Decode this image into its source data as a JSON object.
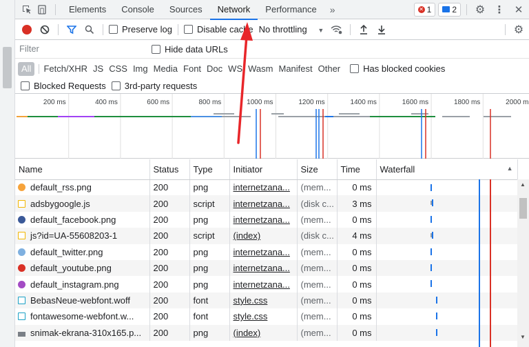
{
  "tabs": [
    "Elements",
    "Console",
    "Sources",
    "Network",
    "Performance"
  ],
  "active_tab": "Network",
  "more_tabs": "»",
  "error_count": "1",
  "message_count": "2",
  "toolbar": {
    "preserve_log": "Preserve log",
    "disable_cache": "Disable cache",
    "throttling": "No throttling"
  },
  "filter": {
    "placeholder": "Filter",
    "hide_data_urls": "Hide data URLs",
    "types": [
      "All",
      "Fetch/XHR",
      "JS",
      "CSS",
      "Img",
      "Media",
      "Font",
      "Doc",
      "WS",
      "Wasm",
      "Manifest",
      "Other"
    ],
    "has_blocked_cookies": "Has blocked cookies",
    "blocked_requests": "Blocked Requests",
    "third_party": "3rd-party requests"
  },
  "overview": {
    "ticks": [
      "200 ms",
      "400 ms",
      "600 ms",
      "800 ms",
      "1000 ms",
      "1200 ms",
      "1400 ms",
      "1600 ms",
      "1800 ms",
      "2000 ms"
    ]
  },
  "table": {
    "headers": [
      "Name",
      "Status",
      "Type",
      "Initiator",
      "Size",
      "Time",
      "Waterfall"
    ],
    "rows": [
      {
        "name": "default_rss.png",
        "icon": "rss-image-icon",
        "status": "200",
        "type": "png",
        "initiator": "internetzana...",
        "size": "(mem...",
        "time": "0 ms"
      },
      {
        "name": "adsbygoogle.js",
        "icon": "script-file-icon",
        "status": "200",
        "type": "script",
        "initiator": "internetzana...",
        "size": "(disk c...",
        "time": "3 ms"
      },
      {
        "name": "default_facebook.png",
        "icon": "facebook-image-icon",
        "status": "200",
        "type": "png",
        "initiator": "internetzana...",
        "size": "(mem...",
        "time": "0 ms"
      },
      {
        "name": "js?id=UA-55608203-1",
        "icon": "script-file-icon",
        "status": "200",
        "type": "script",
        "initiator": "(index)",
        "size": "(disk c...",
        "time": "4 ms"
      },
      {
        "name": "default_twitter.png",
        "icon": "twitter-image-icon",
        "status": "200",
        "type": "png",
        "initiator": "internetzana...",
        "size": "(mem...",
        "time": "0 ms"
      },
      {
        "name": "default_youtube.png",
        "icon": "youtube-image-icon",
        "status": "200",
        "type": "png",
        "initiator": "internetzana...",
        "size": "(mem...",
        "time": "0 ms"
      },
      {
        "name": "default_instagram.png",
        "icon": "instagram-image-icon",
        "status": "200",
        "type": "png",
        "initiator": "internetzana...",
        "size": "(mem...",
        "time": "0 ms"
      },
      {
        "name": "BebasNeue-webfont.woff",
        "icon": "font-file-icon",
        "status": "200",
        "type": "font",
        "initiator": "style.css",
        "size": "(mem...",
        "time": "0 ms"
      },
      {
        "name": "fontawesome-webfont.w...",
        "icon": "font-file-icon",
        "status": "200",
        "type": "font",
        "initiator": "style.css",
        "size": "(mem...",
        "time": "0 ms"
      },
      {
        "name": "snimak-ekrana-310x165.p...",
        "icon": "image-file-icon",
        "status": "200",
        "type": "png",
        "initiator": "(index)",
        "size": "(mem...",
        "time": "0 ms"
      }
    ]
  },
  "colors": {
    "accent": "#1a73e8",
    "record": "#d93025",
    "annotation_arrow": "#e8262a"
  }
}
